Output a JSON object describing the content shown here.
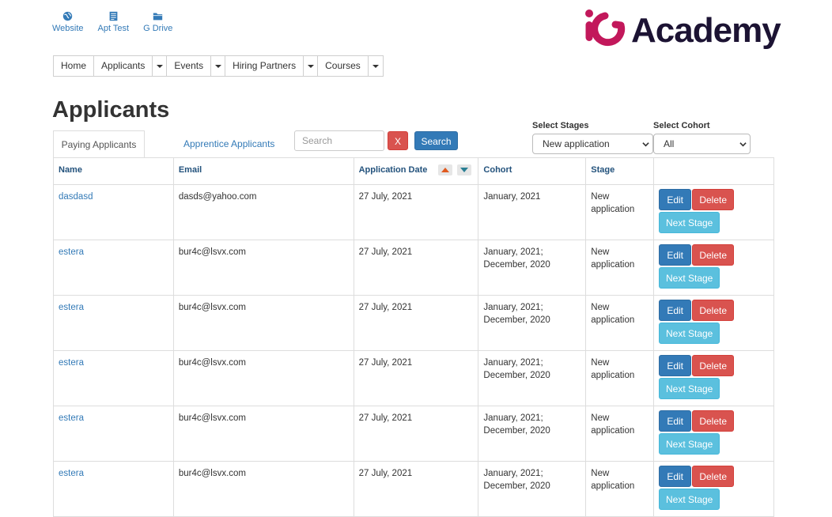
{
  "top_links": [
    {
      "label": "Website",
      "icon": "globe-icon"
    },
    {
      "label": "Apt Test",
      "icon": "document-icon"
    },
    {
      "label": "G Drive",
      "icon": "folder-icon"
    }
  ],
  "logo": {
    "text": "Academy",
    "brand_colors": {
      "mark": "#c2185b",
      "text": "#1c1333"
    }
  },
  "nav": {
    "home": "Home",
    "applicants": "Applicants",
    "events": "Events",
    "hiring_partners": "Hiring Partners",
    "courses": "Courses"
  },
  "page_title": "Applicants",
  "tabs": {
    "paying": "Paying Applicants",
    "apprentice": "Apprentice Applicants"
  },
  "search": {
    "placeholder": "Search",
    "clear_label": "X",
    "button_label": "Search"
  },
  "filters": {
    "stages_label": "Select Stages",
    "stages_value": "New application",
    "cohort_label": "Select Cohort",
    "cohort_value": "All"
  },
  "table": {
    "headers": {
      "name": "Name",
      "email": "Email",
      "date": "Application Date",
      "cohort": "Cohort",
      "stage": "Stage"
    },
    "actions": {
      "edit": "Edit",
      "delete": "Delete",
      "next": "Next Stage"
    },
    "rows": [
      {
        "name": "dasdasd",
        "email": "dasds@yahoo.com",
        "date": "27 July, 2021",
        "cohort_1": "January, 2021",
        "cohort_2": "",
        "stage_1": "New",
        "stage_2": "application"
      },
      {
        "name": "estera",
        "email": "bur4c@lsvx.com",
        "date": "27 July, 2021",
        "cohort_1": "January, 2021;",
        "cohort_2": "December, 2020",
        "stage_1": "New",
        "stage_2": "application"
      },
      {
        "name": "estera",
        "email": "bur4c@lsvx.com",
        "date": "27 July, 2021",
        "cohort_1": "January, 2021;",
        "cohort_2": "December, 2020",
        "stage_1": "New",
        "stage_2": "application"
      },
      {
        "name": "estera",
        "email": "bur4c@lsvx.com",
        "date": "27 July, 2021",
        "cohort_1": "January, 2021;",
        "cohort_2": "December, 2020",
        "stage_1": "New",
        "stage_2": "application"
      },
      {
        "name": "estera",
        "email": "bur4c@lsvx.com",
        "date": "27 July, 2021",
        "cohort_1": "January, 2021;",
        "cohort_2": "December, 2020",
        "stage_1": "New",
        "stage_2": "application"
      },
      {
        "name": "estera",
        "email": "bur4c@lsvx.com",
        "date": "27 July, 2021",
        "cohort_1": "January, 2021;",
        "cohort_2": "December, 2020",
        "stage_1": "New",
        "stage_2": "application"
      }
    ]
  }
}
